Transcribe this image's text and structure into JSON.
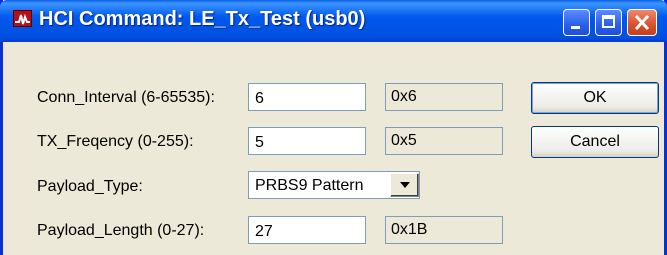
{
  "window": {
    "title": "HCI Command: LE_Tx_Test (usb0)",
    "icons": {
      "app": "app-icon",
      "minimize": "minimize-icon",
      "maximize": "maximize-icon",
      "close": "close-icon"
    }
  },
  "fields": [
    {
      "label": "Conn_Interval (6-65535):",
      "value": "6",
      "hex": "0x6"
    },
    {
      "label": "TX_Freqency (0-255):",
      "value": "5",
      "hex": "0x5"
    },
    {
      "label": "Payload_Type:",
      "selected": "PRBS9 Pattern"
    },
    {
      "label": "Payload_Length (0-27):",
      "value": "27",
      "hex": "0x1B"
    }
  ],
  "buttons": {
    "ok": "OK",
    "cancel": "Cancel"
  },
  "colors": {
    "titlebar": "#0058ee",
    "face": "#ece9d8",
    "field_border": "#7f9db9",
    "close_button": "#d8502c"
  }
}
